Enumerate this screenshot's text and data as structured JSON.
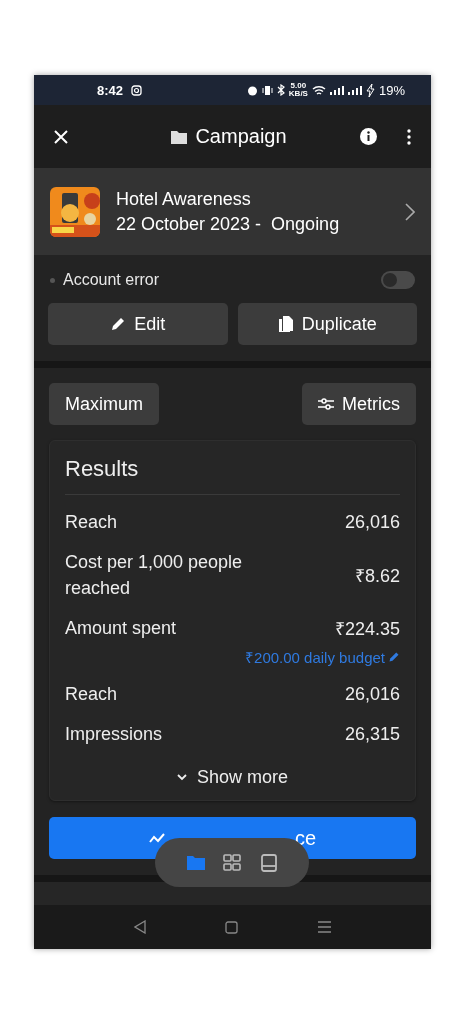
{
  "status_bar": {
    "time": "8:42",
    "speed_value": "5.00",
    "speed_unit": "KB/S",
    "battery": "19%"
  },
  "header": {
    "title": "Campaign"
  },
  "campaign": {
    "name": "Hotel Awareness",
    "dates": "22 October 2023 -  Ongoing"
  },
  "status": {
    "label": "Account error",
    "on": false
  },
  "actions": [
    {
      "kind": "edit",
      "label": "Edit"
    },
    {
      "kind": "duplicate",
      "label": "Duplicate"
    }
  ],
  "chips": [
    {
      "kind": "plain",
      "label": "Maximum"
    },
    {
      "kind": "metrics",
      "label": "Metrics"
    }
  ],
  "results": {
    "title": "Results",
    "rows": [
      {
        "label": "Reach",
        "value": "26,016"
      },
      {
        "label": "Cost per 1,000 people reached",
        "value": "₹8.62"
      },
      {
        "label": "Amount spent",
        "value": "₹224.35",
        "link": "₹200.00 daily budget"
      },
      {
        "label": "Reach",
        "value": "26,016"
      },
      {
        "label": "Impressions",
        "value": "26,315"
      }
    ],
    "show_more": "Show more"
  },
  "performance_button": {
    "label_visible_end": "ce"
  },
  "floating_nav": [
    {
      "kind": "folder",
      "selected": true
    },
    {
      "kind": "grid",
      "selected": false
    },
    {
      "kind": "tablet",
      "selected": false
    }
  ]
}
